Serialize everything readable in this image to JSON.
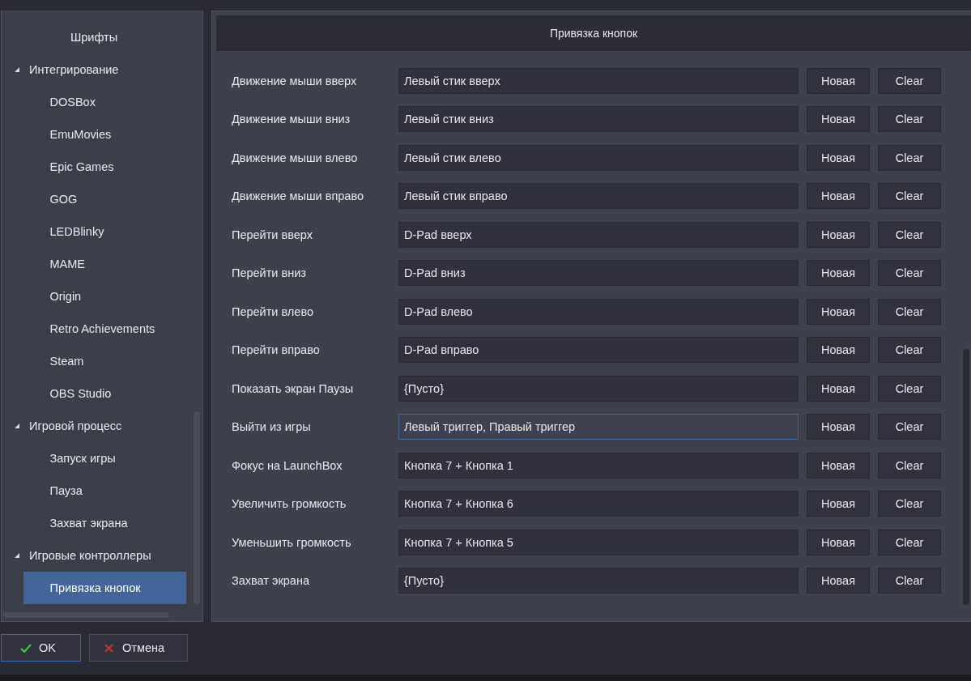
{
  "sidebar": {
    "tree": [
      {
        "children": [
          {
            "children": [
              {
                "label": "Шрифты",
                "selected": false
              }
            ]
          }
        ]
      },
      {
        "label": "Интегрирование",
        "expanded": true,
        "selected": false,
        "children": [
          {
            "label": "DOSBox",
            "selected": false
          },
          {
            "label": "EmuMovies",
            "selected": false
          },
          {
            "label": "Epic Games",
            "selected": false
          },
          {
            "label": "GOG",
            "selected": false
          },
          {
            "label": "LEDBlinky",
            "selected": false
          },
          {
            "label": "MAME",
            "selected": false
          },
          {
            "label": "Origin",
            "selected": false
          },
          {
            "label": "Retro Achievements",
            "selected": false
          },
          {
            "label": "Steam",
            "selected": false
          },
          {
            "label": "OBS Studio",
            "selected": false
          }
        ]
      },
      {
        "label": "Игровой процесс",
        "expanded": true,
        "selected": false,
        "children": [
          {
            "label": "Запуск игры",
            "selected": false
          },
          {
            "label": "Пауза",
            "selected": false
          },
          {
            "label": "Захват экрана",
            "selected": false
          }
        ]
      },
      {
        "label": "Игровые контроллеры",
        "expanded": true,
        "selected": false,
        "children": [
          {
            "label": "Привязка кнопок",
            "selected": true
          }
        ]
      }
    ]
  },
  "panel": {
    "title": "Привязка кнопок",
    "rows": [
      {
        "action": "Движение мыши вверх",
        "binding": "Левый стик вверх",
        "focused": false,
        "buttons": [
          "Новая",
          "Clear"
        ]
      },
      {
        "action": "Движение мыши вниз",
        "binding": "Левый стик вниз",
        "focused": false,
        "buttons": [
          "Новая",
          "Clear"
        ]
      },
      {
        "action": "Движение мыши влево",
        "binding": "Левый стик влево",
        "focused": false,
        "buttons": [
          "Новая",
          "Clear"
        ]
      },
      {
        "action": "Движение мыши вправо",
        "binding": "Левый стик вправо",
        "focused": false,
        "buttons": [
          "Новая",
          "Clear"
        ]
      },
      {
        "action": "Перейти вверх",
        "binding": "D-Pad вверх",
        "focused": false,
        "buttons": [
          "Новая",
          "Clear"
        ]
      },
      {
        "action": "Перейти вниз",
        "binding": "D-Pad вниз",
        "focused": false,
        "buttons": [
          "Новая",
          "Clear"
        ]
      },
      {
        "action": "Перейти влево",
        "binding": "D-Pad влево",
        "focused": false,
        "buttons": [
          "Новая",
          "Clear"
        ]
      },
      {
        "action": "Перейти вправо",
        "binding": "D-Pad вправо",
        "focused": false,
        "buttons": [
          "Новая",
          "Clear"
        ]
      },
      {
        "action": "Показать экран Паузы",
        "binding": "{Пусто}",
        "focused": false,
        "buttons": [
          "Новая",
          "Clear"
        ]
      },
      {
        "action": "Выйти из игры",
        "binding": "Левый триггер, Правый триггер",
        "focused": true,
        "buttons": [
          "Новая",
          "Clear"
        ]
      },
      {
        "action": "Фокус на LaunchBox",
        "binding": "Кнопка 7 + Кнопка 1",
        "focused": false,
        "buttons": [
          "Новая",
          "Clear"
        ]
      },
      {
        "action": "Увеличить громкость",
        "binding": "Кнопка 7 + Кнопка 6",
        "focused": false,
        "buttons": [
          "Новая",
          "Clear"
        ]
      },
      {
        "action": "Уменьшить громкость",
        "binding": "Кнопка 7 + Кнопка 5",
        "focused": false,
        "buttons": [
          "Новая",
          "Clear"
        ]
      },
      {
        "action": "Захват экрана",
        "binding": "{Пусто}",
        "focused": false,
        "buttons": [
          "Новая",
          "Clear"
        ]
      }
    ]
  },
  "footer": {
    "buttons": [
      {
        "label": "OK",
        "kind": "confirm",
        "focused": true
      },
      {
        "label": "Отмена",
        "kind": "cancel",
        "focused": false
      }
    ]
  }
}
